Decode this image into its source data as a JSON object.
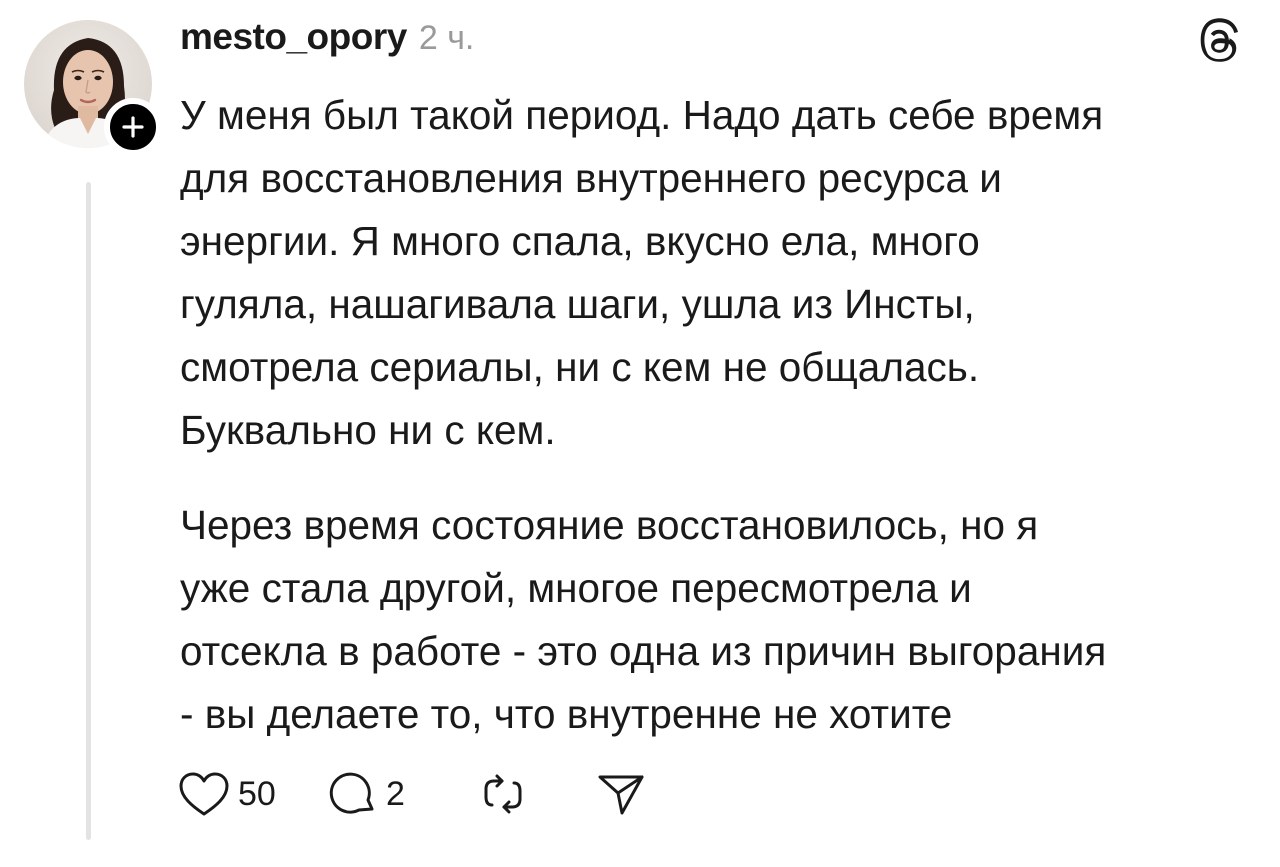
{
  "post": {
    "username": "mesto_opory",
    "timestamp": "2 ч.",
    "paragraphs": [
      "У меня был такой период. Надо дать себе время\nдля восстановления внутреннего ресурса и\nэнергии. Я много спала, вкусно ела, много\nгуляла, нашагивала шаги, ушла из Инсты,\nсмотрела сериалы, ни с кем не общалась.\nБуквально ни с кем.",
      "Через время состояние  восстановилось, но я\nуже стала другой, многое пересмотрела и\nотсекла в работе - это одна из причин выгорания\n- вы делаете то, что внутренне не хотите"
    ],
    "likes": "50",
    "replies": "2"
  },
  "icons": {
    "avatar": "avatar-photo",
    "follow": "plus-icon",
    "brand": "threads-logo-icon",
    "like": "heart-icon",
    "reply": "comment-icon",
    "repost": "repost-icon",
    "share": "send-icon"
  },
  "colors": {
    "text": "#1a1a1a",
    "muted": "#9a9a9a",
    "thread_line": "#e3e3e3",
    "follow_button": "#000000"
  }
}
